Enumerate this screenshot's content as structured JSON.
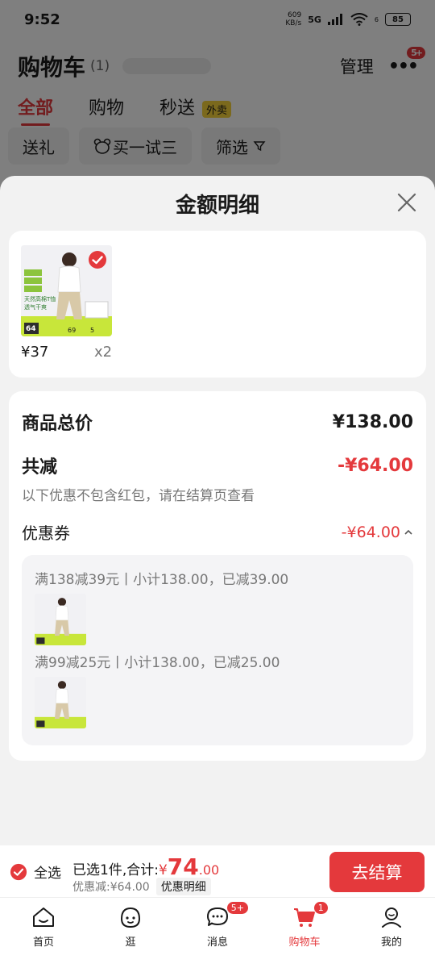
{
  "status_bar": {
    "time": "9:52",
    "net_speed_value": "609",
    "net_speed_unit": "KB/s",
    "signal": "5G",
    "wifi_level": "6",
    "battery": "85"
  },
  "cart_header": {
    "title": "购物车",
    "count": "(1)",
    "manage": "管理",
    "more_badge": "5+"
  },
  "cart_tabs": [
    {
      "label": "全部"
    },
    {
      "label": "购物"
    },
    {
      "label": "秒送",
      "badge": "外卖"
    }
  ],
  "filters": [
    {
      "label": "送礼"
    },
    {
      "label": "买一试三"
    },
    {
      "label": "筛选"
    }
  ],
  "sheet": {
    "title": "金额明细",
    "product": {
      "price": "¥37",
      "qty": "x2",
      "thumb_text": {
        "line1": "天然高棉T恤",
        "line2": "透气干爽",
        "num1": "64",
        "num2": "69",
        "num3": "5"
      }
    },
    "total": {
      "label": "商品总价",
      "value": "¥138.00"
    },
    "reduce": {
      "label": "共减",
      "value": "-¥64.00",
      "note": "以下优惠不包含红包，请在结算页查看"
    },
    "coupon": {
      "label": "优惠券",
      "value": "-¥64.00"
    },
    "coupon_rules": [
      {
        "text": "满138减39元丨小计138.00，已减39.00"
      },
      {
        "text": "满99减25元丨小计138.00，已减25.00"
      }
    ]
  },
  "checkout": {
    "select_all": "全选",
    "summary_prefix": "已选1件,合计:",
    "currency": "¥",
    "amount_int": "74",
    "amount_dec": ".00",
    "discount_text": "优惠减:¥64.00",
    "detail_tag": "优惠明细",
    "button": "去结算"
  },
  "tabbar": [
    {
      "label": "首页"
    },
    {
      "label": "逛"
    },
    {
      "label": "消息",
      "badge": "5+"
    },
    {
      "label": "购物车",
      "badge": "1"
    },
    {
      "label": "我的"
    }
  ],
  "colors": {
    "accent": "#e4393c",
    "sheet_bg": "#f2f2f2",
    "card_bg": "#ffffff",
    "muted": "#777777"
  }
}
